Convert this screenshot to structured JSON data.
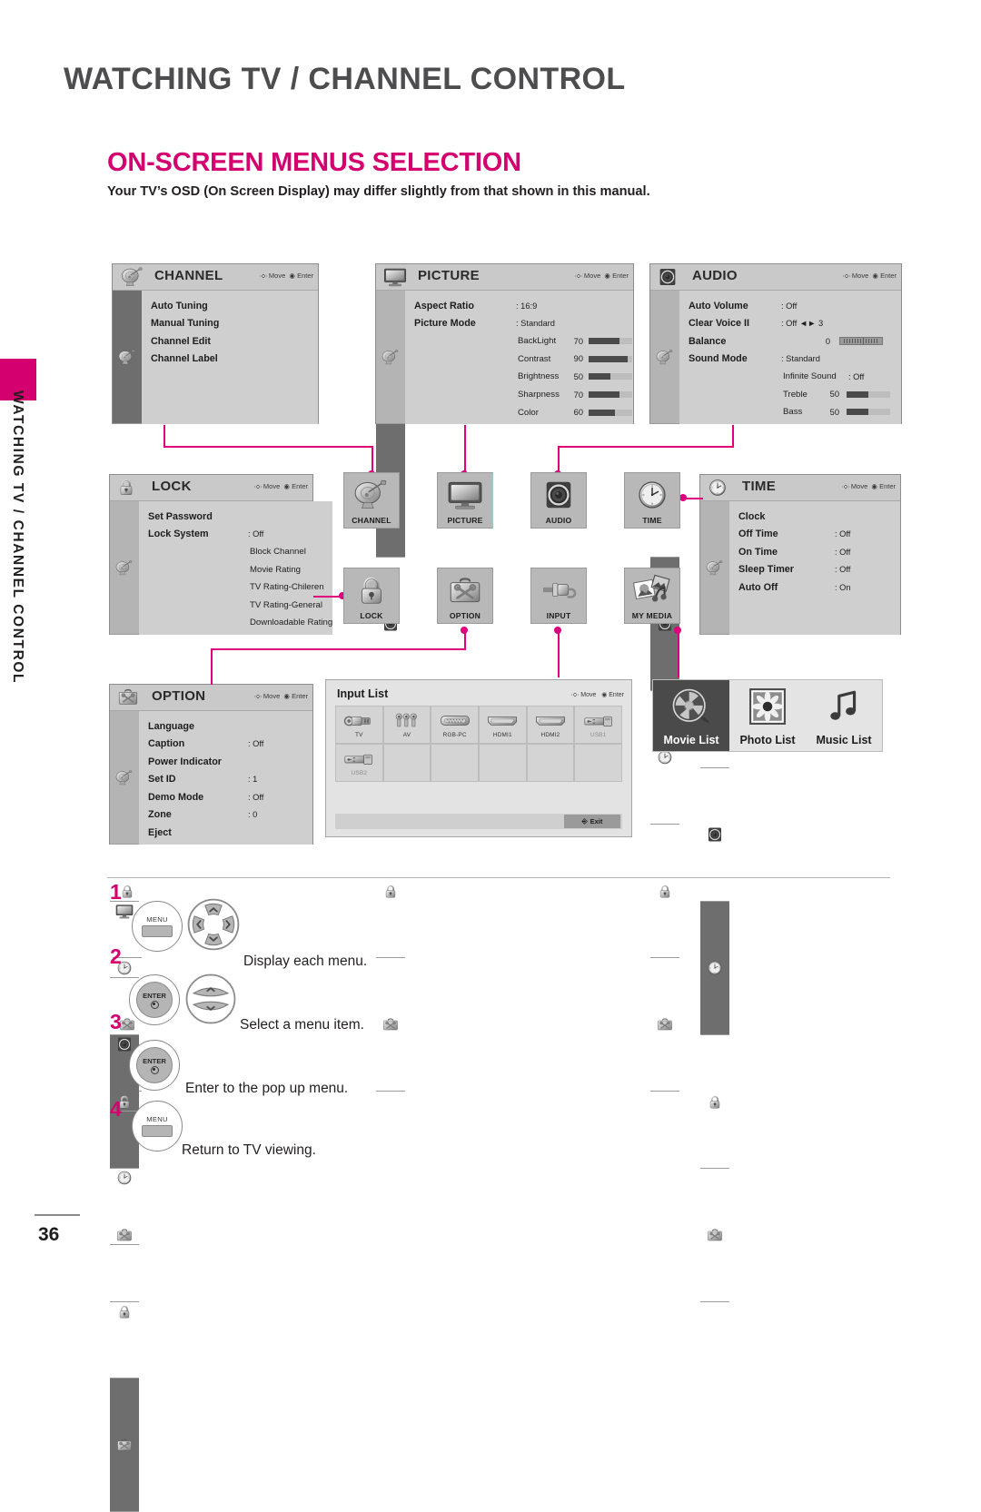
{
  "page": {
    "title": "WATCHING TV / CHANNEL CONTROL",
    "section_title": "ON-SCREEN MENUS SELECTION",
    "section_subtitle": "Your TV’s OSD (On Screen Display) may differ slightly from that shown in this manual.",
    "side_tab_label": "WATCHING TV / CHANNEL CONTROL",
    "page_number": "36",
    "accent_color": "#D4006F",
    "connector_color": "#E0007E"
  },
  "osd_hint": {
    "move": "Move",
    "enter": "Enter"
  },
  "menus": {
    "channel": {
      "title": "CHANNEL",
      "icon": "satellite-dish-icon",
      "active_rail_index": 0,
      "rows": [
        {
          "label": "Auto Tuning",
          "value": ""
        },
        {
          "label": "Manual Tuning",
          "value": ""
        },
        {
          "label": "Channel Edit",
          "value": ""
        },
        {
          "label": "Channel Label",
          "value": ""
        }
      ]
    },
    "picture": {
      "title": "PICTURE",
      "icon": "monitor-icon",
      "active_rail_index": 1,
      "rows": [
        {
          "label": "Aspect Ratio",
          "value": ": 16:9"
        },
        {
          "label": "Picture Mode",
          "value": ": Standard"
        }
      ],
      "sliders": [
        {
          "label": "BackLight",
          "value": "70",
          "pct": 70
        },
        {
          "label": "Contrast",
          "value": "90",
          "pct": 90
        },
        {
          "label": "Brightness",
          "value": "50",
          "pct": 50
        },
        {
          "label": "Sharpness",
          "value": "70",
          "pct": 70
        },
        {
          "label": "Color",
          "value": "60",
          "pct": 60
        }
      ]
    },
    "audio": {
      "title": "AUDIO",
      "icon": "speaker-icon",
      "active_rail_index": 2,
      "rows": [
        {
          "label": "Auto Volume",
          "value": ": Off"
        },
        {
          "label": "Clear Voice II",
          "value": ": Off  ◄► 3"
        },
        {
          "label": "Balance",
          "value": "",
          "number": "0"
        },
        {
          "label": "Sound Mode",
          "value": ": Standard"
        }
      ],
      "subrows": [
        {
          "label": "Infinite Sound",
          "value": ": Off"
        }
      ],
      "sliders": [
        {
          "label": "Treble",
          "value": "50",
          "pct": 50
        },
        {
          "label": "Bass",
          "value": "50",
          "pct": 50
        }
      ]
    },
    "lock": {
      "title": "LOCK",
      "icon": "lock-icon",
      "active_rail_index": 4,
      "rows": [
        {
          "label": "Set Password",
          "value": ""
        },
        {
          "label": "Lock System",
          "value": ": Off"
        }
      ],
      "subrows": [
        {
          "label": "Block Channel"
        },
        {
          "label": "Movie Rating"
        },
        {
          "label": "TV Rating-Chileren"
        },
        {
          "label": "TV Rating-General"
        },
        {
          "label": "Downloadable Rating"
        }
      ]
    },
    "time": {
      "title": "TIME",
      "icon": "clock-icon",
      "active_rail_index": 3,
      "rows": [
        {
          "label": "Clock",
          "value": ""
        },
        {
          "label": "Off Time",
          "value": ": Off"
        },
        {
          "label": "On Time",
          "value": ": Off"
        },
        {
          "label": "Sleep Timer",
          "value": ": Off"
        },
        {
          "label": "Auto Off",
          "value": ": On"
        }
      ]
    },
    "option": {
      "title": "OPTION",
      "icon": "toolbox-icon",
      "active_rail_index": 5,
      "rows": [
        {
          "label": "Language",
          "value": ""
        },
        {
          "label": "Caption",
          "value": ": Off"
        },
        {
          "label": "Power Indicator",
          "value": ""
        },
        {
          "label": "Set ID",
          "value": ": 1"
        },
        {
          "label": "Demo Mode",
          "value": ": Off"
        },
        {
          "label": "Zone",
          "value": ": 0"
        },
        {
          "label": "Eject",
          "value": ""
        }
      ]
    }
  },
  "tiles": [
    {
      "label": "CHANNEL",
      "icon": "satellite-dish-icon"
    },
    {
      "label": "PICTURE",
      "icon": "monitor-icon"
    },
    {
      "label": "AUDIO",
      "icon": "speaker-icon"
    },
    {
      "label": "TIME",
      "icon": "clock-icon"
    },
    {
      "label": "LOCK",
      "icon": "padlock-icon"
    },
    {
      "label": "OPTION",
      "icon": "toolbox-icon"
    },
    {
      "label": "INPUT",
      "icon": "plug-icon"
    },
    {
      "label": "MY MEDIA",
      "icon": "media-photos-icon"
    }
  ],
  "input_list": {
    "title": "Input List",
    "hint_move": "Move",
    "hint_enter": "Enter",
    "exit_label": "Exit",
    "sources": [
      {
        "label": "TV",
        "icon": "antenna-connector-icon",
        "dim": false
      },
      {
        "label": "AV",
        "icon": "rca-jacks-icon",
        "dim": false
      },
      {
        "label": "RGB-PC",
        "icon": "vga-connector-icon",
        "dim": false
      },
      {
        "label": "HDMI1",
        "icon": "hdmi-connector-icon",
        "dim": false
      },
      {
        "label": "HDMI2",
        "icon": "hdmi-connector-icon",
        "dim": false
      },
      {
        "label": "USB1",
        "icon": "usb-connector-icon",
        "dim": true
      },
      {
        "label": "USB2",
        "icon": "usb-connector-icon",
        "dim": true
      }
    ]
  },
  "my_media": [
    {
      "label": "Movie List",
      "icon": "film-reel-icon",
      "selected": true
    },
    {
      "label": "Photo List",
      "icon": "flower-photo-icon",
      "selected": false
    },
    {
      "label": "Music List",
      "icon": "music-note-icon",
      "selected": false
    }
  ],
  "steps": [
    {
      "num": "1",
      "buttons": [
        "MENU",
        "dpad"
      ],
      "text": "Display each menu."
    },
    {
      "num": "2",
      "buttons": [
        "ENTER",
        "updown"
      ],
      "text": "Select a menu item."
    },
    {
      "num": "3",
      "buttons": [
        "ENTER"
      ],
      "text": "Enter to the pop up menu."
    },
    {
      "num": "4",
      "buttons": [
        "MENU"
      ],
      "text": "Return to TV viewing."
    }
  ],
  "remote_labels": {
    "menu": "MENU",
    "enter": "ENTER"
  }
}
